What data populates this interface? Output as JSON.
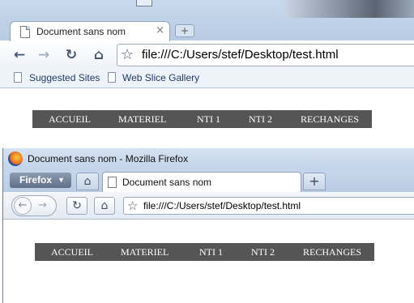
{
  "chrome": {
    "tab_title": "Document sans nom",
    "tab_close": "×",
    "new_tab": "+",
    "nav": {
      "back": "←",
      "forward": "→",
      "reload": "↻",
      "home": "⌂"
    },
    "star": "☆",
    "address": "file:///C:/Users/stef/Desktop/test.html",
    "bookmarks": [
      {
        "label": "Suggested Sites",
        "icon": "page-icon"
      },
      {
        "label": "Web Slice Gallery",
        "icon": "page-icon"
      }
    ],
    "menu": [
      "ACCUEIL",
      "MATERIEL",
      "NTI 1",
      "NTI 2",
      "RECHANGES"
    ]
  },
  "firefox": {
    "window_title": "Document sans nom - Mozilla Firefox",
    "menu_button": "Firefox",
    "menu_caret": "▼",
    "home": "⌂",
    "tab_title": "Document sans nom",
    "new_tab": "+",
    "nav": {
      "back": "←",
      "forward": "→",
      "reload": "↻",
      "home": "⌂"
    },
    "star": "☆",
    "address": "file:///C:/Users/stef/Desktop/test.html",
    "menu": [
      "ACCUEIL",
      "MATERIEL",
      "NTI 1",
      "NTI 2",
      "RECHANGES"
    ]
  },
  "colors": {
    "menubar_bg": "#555555",
    "menubar_text": "#ffffff",
    "chrome_frame": "#c9d9ec"
  }
}
